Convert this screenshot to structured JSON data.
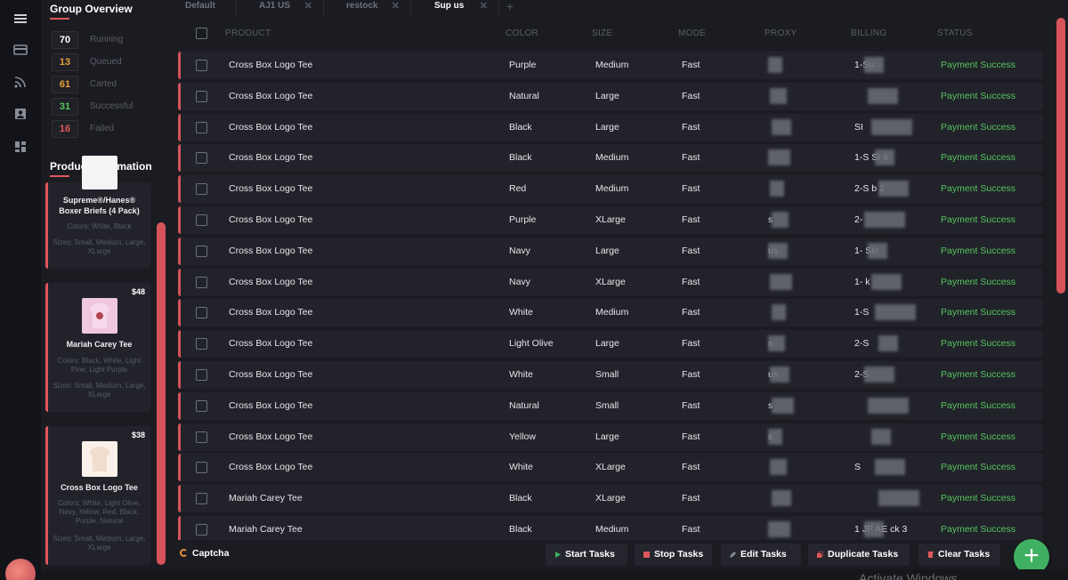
{
  "sidebar_rail": {
    "icons": [
      "menu-icon",
      "card-icon",
      "rss-icon",
      "profile-icon",
      "dashboard-icon"
    ]
  },
  "group_overview": {
    "title": "Group Overview",
    "stats": [
      {
        "value": "70",
        "label": "Running",
        "color": "#ffffff"
      },
      {
        "value": "13",
        "label": "Queued",
        "color": "#e8a13a"
      },
      {
        "value": "61",
        "label": "Carted",
        "color": "#e8a13a"
      },
      {
        "value": "31",
        "label": "Successful",
        "color": "#54c45e"
      },
      {
        "value": "16",
        "label": "Failed",
        "color": "#e0575c"
      }
    ]
  },
  "product_information": {
    "title": "Product Information",
    "cards": [
      {
        "price": "",
        "name": "Supreme®/Hanes® Boxer Briefs (4 Pack)",
        "colors": "Colors: White, Black",
        "sizes": "Sizes: Small, Medium, Large, XLarge"
      },
      {
        "price": "$48",
        "name": "Mariah Carey Tee",
        "colors": "Colors: Black, White, Light Pine, Light Purple",
        "sizes": "Sizes: Small, Medium, Large, XLarge"
      },
      {
        "price": "$38",
        "name": "Cross Box Logo Tee",
        "colors": "Colors: White, Light Olive, Navy, Yellow, Red, Black, Purple, Natural",
        "sizes": "Sizes: Small, Medium, Large, XLarge"
      }
    ]
  },
  "tabs": [
    {
      "label": "Default",
      "closable": false
    },
    {
      "label": "AJ1 US",
      "closable": true
    },
    {
      "label": "restock",
      "closable": true
    },
    {
      "label": "Sup us",
      "closable": true,
      "active": true
    }
  ],
  "table": {
    "columns": [
      "PRODUCT",
      "COLOR",
      "SIZE",
      "MODE",
      "PROXY",
      "BILLING",
      "STATUS"
    ],
    "rows": [
      {
        "product": "Cross Box Logo Tee",
        "color": "Purple",
        "size": "Medium",
        "mode": "Fast",
        "proxy": "",
        "billing": "1-Su",
        "status": "Payment Success"
      },
      {
        "product": "Cross Box Logo Tee",
        "color": "Natural",
        "size": "Large",
        "mode": "Fast",
        "proxy": "",
        "billing": "",
        "status": "Payment Success"
      },
      {
        "product": "Cross Box Logo Tee",
        "color": "Black",
        "size": "Large",
        "mode": "Fast",
        "proxy": "",
        "billing": "SI",
        "status": "Payment Success"
      },
      {
        "product": "Cross Box Logo Tee",
        "color": "Black",
        "size": "Medium",
        "mode": "Fast",
        "proxy": "",
        "billing": "1-S SI 6",
        "status": "Payment Success"
      },
      {
        "product": "Cross Box Logo Tee",
        "color": "Red",
        "size": "Medium",
        "mode": "Fast",
        "proxy": "",
        "billing": "2-S b 2",
        "status": "Payment Success"
      },
      {
        "product": "Cross Box Logo Tee",
        "color": "Purple",
        "size": "XLarge",
        "mode": "Fast",
        "proxy": "s",
        "billing": "2-",
        "status": "Payment Success"
      },
      {
        "product": "Cross Box Logo Tee",
        "color": "Navy",
        "size": "Large",
        "mode": "Fast",
        "proxy": "us",
        "billing": "1- Skr",
        "status": "Payment Success"
      },
      {
        "product": "Cross Box Logo Tee",
        "color": "Navy",
        "size": "XLarge",
        "mode": "Fast",
        "proxy": "",
        "billing": "1- k",
        "status": "Payment Success"
      },
      {
        "product": "Cross Box Logo Tee",
        "color": "White",
        "size": "Medium",
        "mode": "Fast",
        "proxy": "",
        "billing": "1-S",
        "status": "Payment Success"
      },
      {
        "product": "Cross Box Logo Tee",
        "color": "Light Olive",
        "size": "Large",
        "mode": "Fast",
        "proxy": "s",
        "billing": "2-S",
        "status": "Payment Success"
      },
      {
        "product": "Cross Box Logo Tee",
        "color": "White",
        "size": "Small",
        "mode": "Fast",
        "proxy": "us",
        "billing": "2-S",
        "status": "Payment Success"
      },
      {
        "product": "Cross Box Logo Tee",
        "color": "Natural",
        "size": "Small",
        "mode": "Fast",
        "proxy": "s",
        "billing": "",
        "status": "Payment Success"
      },
      {
        "product": "Cross Box Logo Tee",
        "color": "Yellow",
        "size": "Large",
        "mode": "Fast",
        "proxy": "s",
        "billing": "",
        "status": "Payment Success"
      },
      {
        "product": "Cross Box Logo Tee",
        "color": "White",
        "size": "XLarge",
        "mode": "Fast",
        "proxy": "",
        "billing": "S",
        "status": "Payment Success"
      },
      {
        "product": "Mariah Carey Tee",
        "color": "Black",
        "size": "XLarge",
        "mode": "Fast",
        "proxy": "",
        "billing": "",
        "status": "Payment Success"
      },
      {
        "product": "Mariah Carey Tee",
        "color": "Black",
        "size": "Medium",
        "mode": "Fast",
        "proxy": "",
        "billing": "1 JP AE ck 3",
        "status": "Payment Success"
      }
    ]
  },
  "bottom_bar": {
    "captcha_label": "Captcha",
    "buttons": [
      {
        "label": "Start Tasks",
        "icon": "play-icon",
        "color": "#3fb061"
      },
      {
        "label": "Stop Tasks",
        "icon": "stop-icon",
        "color": "#e0575c"
      },
      {
        "label": "Edit Tasks",
        "icon": "pencil-icon",
        "color": "#8a8c96"
      },
      {
        "label": "Duplicate Tasks",
        "icon": "copy-icon",
        "color": "#e0575c"
      },
      {
        "label": "Clear Tasks",
        "icon": "trash-icon",
        "color": "#e0575c"
      }
    ],
    "add_label": "+"
  },
  "watermark": "Activate Windows",
  "colors": {
    "accent": "#e0575c",
    "success": "#54c45e",
    "background": "#1b1c21",
    "row": "#22232a"
  }
}
